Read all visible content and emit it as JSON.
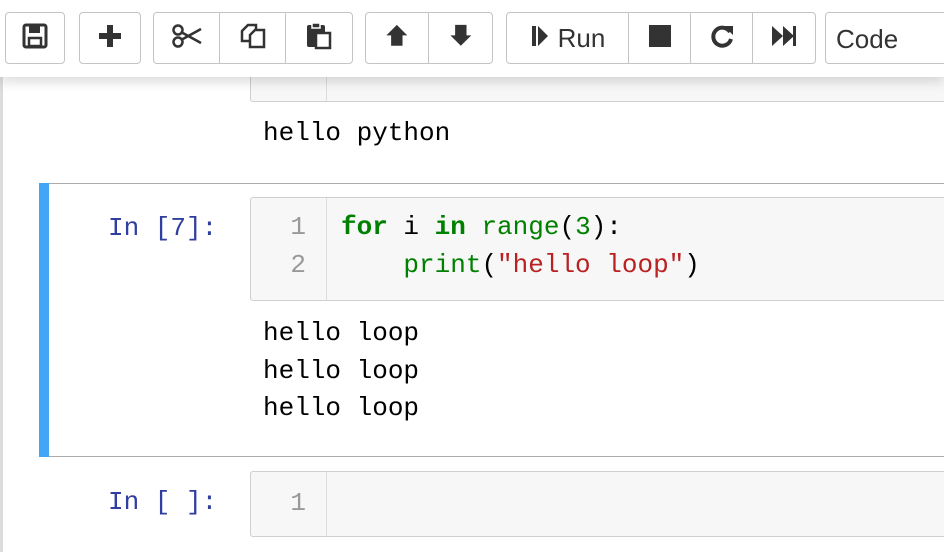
{
  "toolbar": {
    "run_label": "Run",
    "cell_type": "Code",
    "icons": [
      "save-icon",
      "plus-icon",
      "cut-icon",
      "copy-icon",
      "paste-icon",
      "arrow-up-icon",
      "arrow-down-icon",
      "step-forward-icon",
      "stop-icon",
      "restart-icon",
      "fast-forward-icon"
    ]
  },
  "cells": {
    "prev_output": "hello python",
    "selected": {
      "prompt": "In [7]:",
      "line_numbers": [
        "1",
        "2"
      ],
      "line1": {
        "kw1": "for",
        "var": " i ",
        "kw2": "in",
        "fn": " range",
        "p1": "(",
        "num": "3",
        "p2": "):"
      },
      "line2": {
        "indent": "    ",
        "fn": "print",
        "p1": "(",
        "str": "\"hello loop\"",
        "p2": ")"
      },
      "output": [
        "hello loop",
        "hello loop",
        "hello loop"
      ]
    },
    "empty": {
      "prompt": "In [ ]:",
      "line_number": "1"
    }
  },
  "colors": {
    "selected_bar": "#42a5f5",
    "keyword": "#008000",
    "string": "#ba2121",
    "prompt": "#303f9f"
  }
}
